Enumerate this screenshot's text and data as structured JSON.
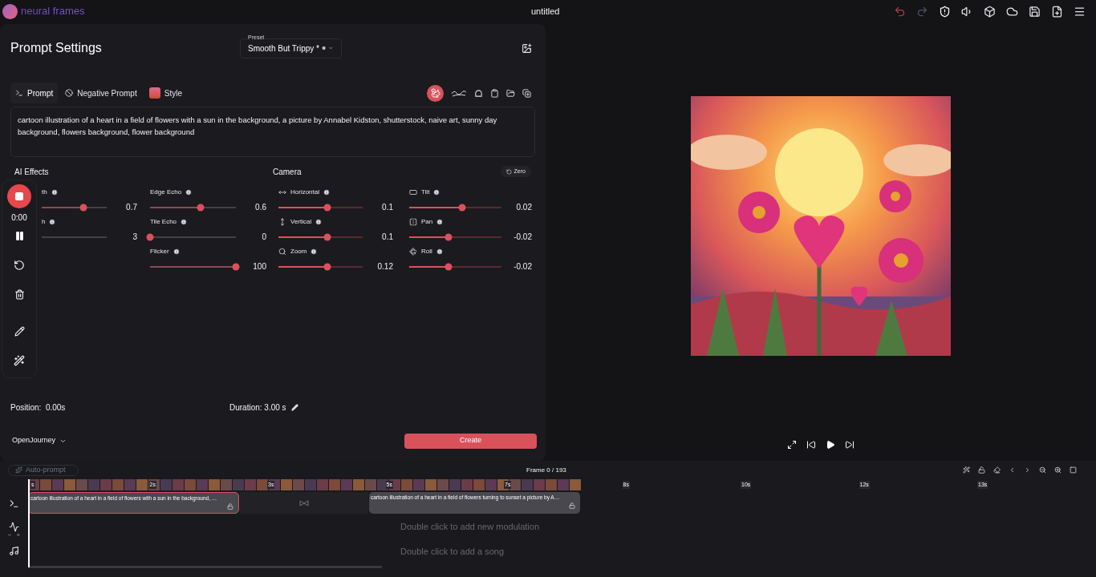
{
  "app": {
    "name": "neural frames",
    "title": "untitled"
  },
  "prompt_settings": {
    "title": "Prompt Settings",
    "preset": {
      "label": "Preset",
      "value": "Smooth But Trippy *"
    },
    "tabs": [
      {
        "label": "Prompt",
        "selected": true
      },
      {
        "label": "Negative Prompt",
        "selected": false
      },
      {
        "label": "Style",
        "selected": false
      }
    ],
    "prompt_text": "cartoon illustration of a heart in a field of flowers with a sun in the background, a picture by Annabel Kidston, shutterstock, naive art, sunny day background, flowers background, flower background",
    "ai_effects": {
      "title": "AI Effects",
      "columns": [
        [
          {
            "label": "th",
            "value": "0.7",
            "level": 0.64
          },
          {
            "label": "h",
            "value": "3"
          }
        ],
        [
          {
            "label": "Edge Echo",
            "value": "0.6",
            "level": 0.59
          },
          {
            "label": "Tile Echo",
            "value": "0",
            "level": 0
          },
          {
            "label": "Flicker",
            "value": "100",
            "level": 1
          }
        ]
      ]
    },
    "camera": {
      "title": "Camera",
      "zero_button": "Zero",
      "columns": [
        [
          {
            "label": "Horizontal",
            "value": "0.1",
            "level": 0.58
          },
          {
            "label": "Vertical",
            "value": "0.1",
            "level": 0.58
          },
          {
            "label": "Zoom",
            "value": "0.12",
            "level": 0.58
          }
        ],
        [
          {
            "label": "Tilt",
            "value": "0.02",
            "level": 0.57
          },
          {
            "label": "Pan",
            "value": "-0.02",
            "level": 0.43
          },
          {
            "label": "Roll",
            "value": "-0.02",
            "level": 0.43
          }
        ]
      ]
    },
    "position": "Position:  0.00s",
    "duration": "Duration: 3.00 s",
    "model": "OpenJourney",
    "create_button": "Create"
  },
  "recorder": {
    "time": "0:00"
  },
  "timeline": {
    "auto_prompt": "Auto-prompt",
    "frame": "Frame 0 / 193",
    "ticks": [
      "s",
      "2s",
      "3s",
      "5s",
      "7s",
      "8s",
      "10s",
      "12s",
      "13s"
    ],
    "clips": [
      {
        "text": "cartoon illustration of a heart in a field of flowers with a sun in the background, …",
        "selected": true
      },
      {
        "text": "cartoon illustration of a heart in a field of flowers turning to sunset a picture by A…",
        "selected": false
      }
    ],
    "modulation_hint": "Double click to add new modulation",
    "song_hint": "Double click to add a song",
    "zoom_minus": "−",
    "zoom_plus": "+"
  }
}
